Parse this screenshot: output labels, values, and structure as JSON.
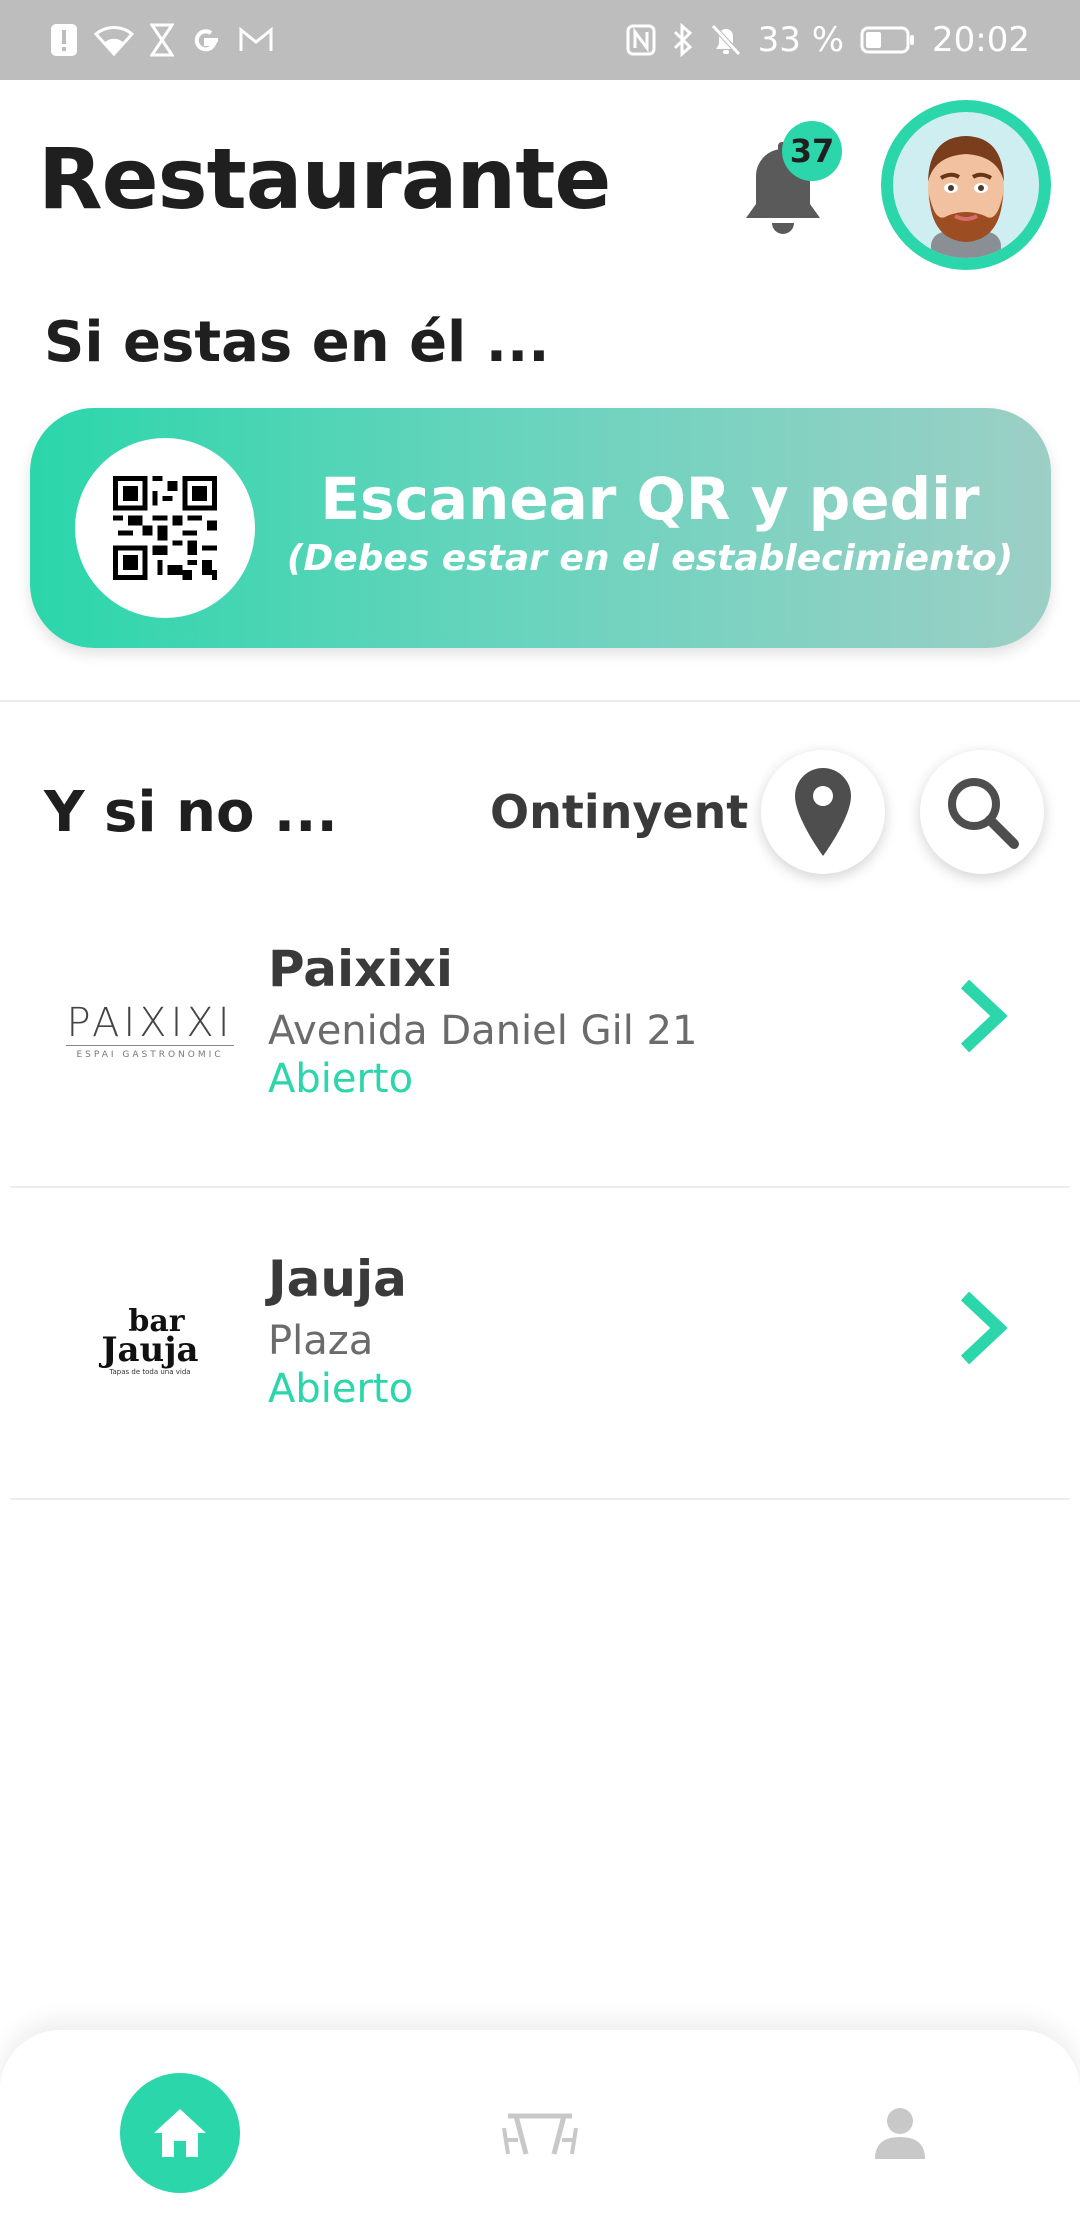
{
  "status_bar": {
    "battery": "33 %",
    "time": "20:02"
  },
  "header": {
    "title": "Restaurante",
    "notification_count": "37"
  },
  "scan_section": {
    "heading": "Si estas en él ...",
    "button_title": "Escanear QR y pedir",
    "button_subtitle": "(Debes estar en el establecimiento)"
  },
  "list_section": {
    "heading": "Y si no ...",
    "city": "Ontinyent",
    "restaurants": [
      {
        "name": "Paixixi",
        "address": "Avenida Daniel Gil 21",
        "status": "Abierto",
        "logo_text": "PAIXIXI",
        "logo_subtext": "ESPAI GASTRONOMIC"
      },
      {
        "name": "Jauja",
        "address": "Plaza",
        "status": "Abierto",
        "logo_text_top": "bar",
        "logo_text_main": "Jauja",
        "logo_subtext": "Tapas de toda una vida"
      }
    ]
  },
  "icons": {
    "bell": "bell-icon",
    "location": "location-pin-icon",
    "search": "search-icon",
    "home": "home-icon",
    "tables": "tables-icon",
    "user": "user-icon",
    "chevron": "chevron-right-icon"
  },
  "colors": {
    "accent": "#2bd6aa",
    "status_bar": "#bdbdbd",
    "text_dark": "#1f1f1f",
    "text_muted": "#6b6b6b"
  }
}
